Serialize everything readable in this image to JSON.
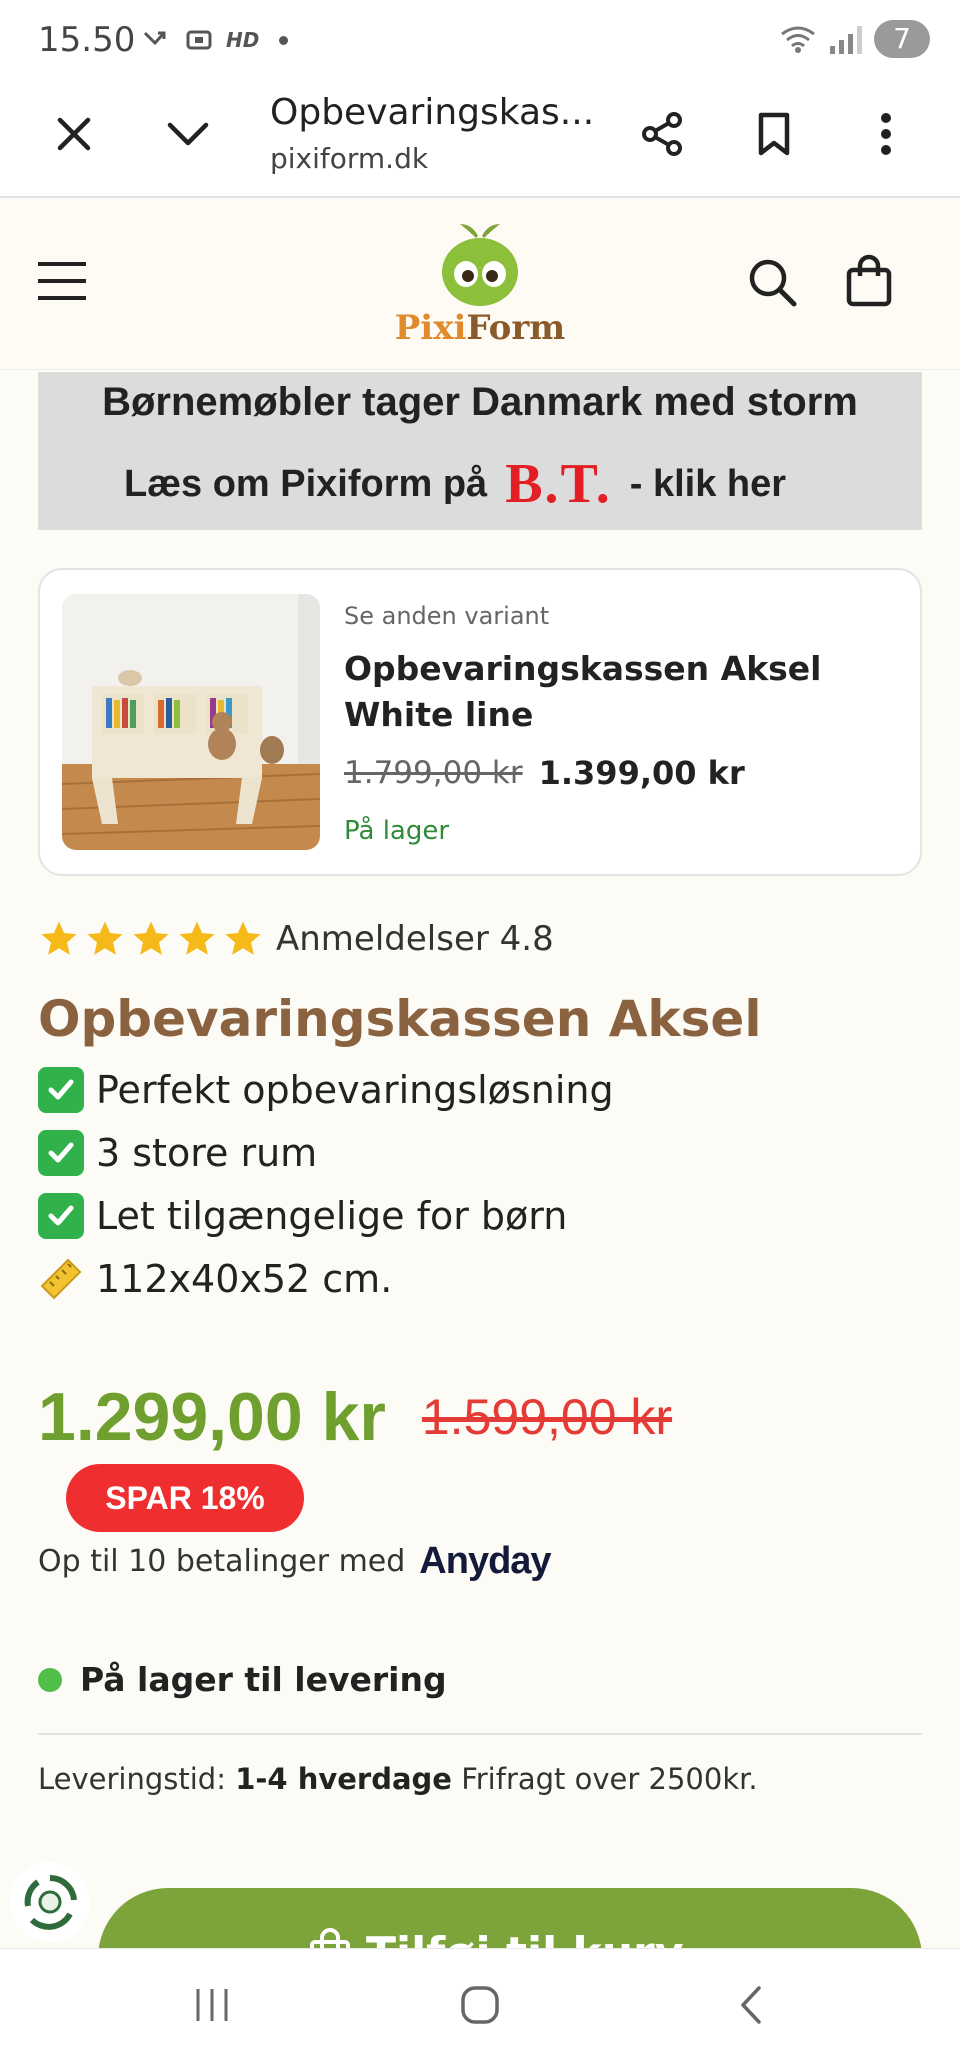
{
  "status_bar": {
    "time": "15.50",
    "hd_label": "HD",
    "notification_count": "7"
  },
  "browser": {
    "page_title": "Opbevaringskas...",
    "url": "pixiform.dk"
  },
  "site": {
    "logo_pixi": "Pixi",
    "logo_form": "Form"
  },
  "banner": {
    "line1": "Børnemøbler tager Danmark med storm",
    "line2_prefix": "Læs om Pixiform på",
    "bt_logo": "B.T.",
    "line2_suffix": "- klik her"
  },
  "variant": {
    "label": "Se anden variant",
    "name": "Opbevaringskassen Aksel White line",
    "old_price": "1.799,00 kr",
    "new_price": "1.399,00 kr",
    "stock": "På lager"
  },
  "reviews": {
    "stars": 5,
    "text": "Anmeldelser 4.8"
  },
  "product": {
    "title": "Opbevaringskassen Aksel",
    "features": [
      "Perfekt opbevaringsløsning",
      "3 store rum",
      "Let tilgængelige for børn"
    ],
    "dimensions": "112x40x52 cm.",
    "price": "1.299,00 kr",
    "old_price": "1.599,00 kr",
    "save_label": "SPAR  18%",
    "installments_text": "Op til 10 betalinger med",
    "installments_brand": "Anyday",
    "stock_text": "På lager til levering",
    "delivery_label": "Leveringstid:",
    "delivery_time": "1-4 hverdage",
    "delivery_note": "Frifragt over 2500kr.",
    "add_to_cart": "Tilføj til kurv"
  },
  "colors": {
    "brand_green": "#7ca43a",
    "title_brown": "#8a6240",
    "sale_red": "#ef2f2f",
    "stock_green": "#2f8a3a"
  }
}
